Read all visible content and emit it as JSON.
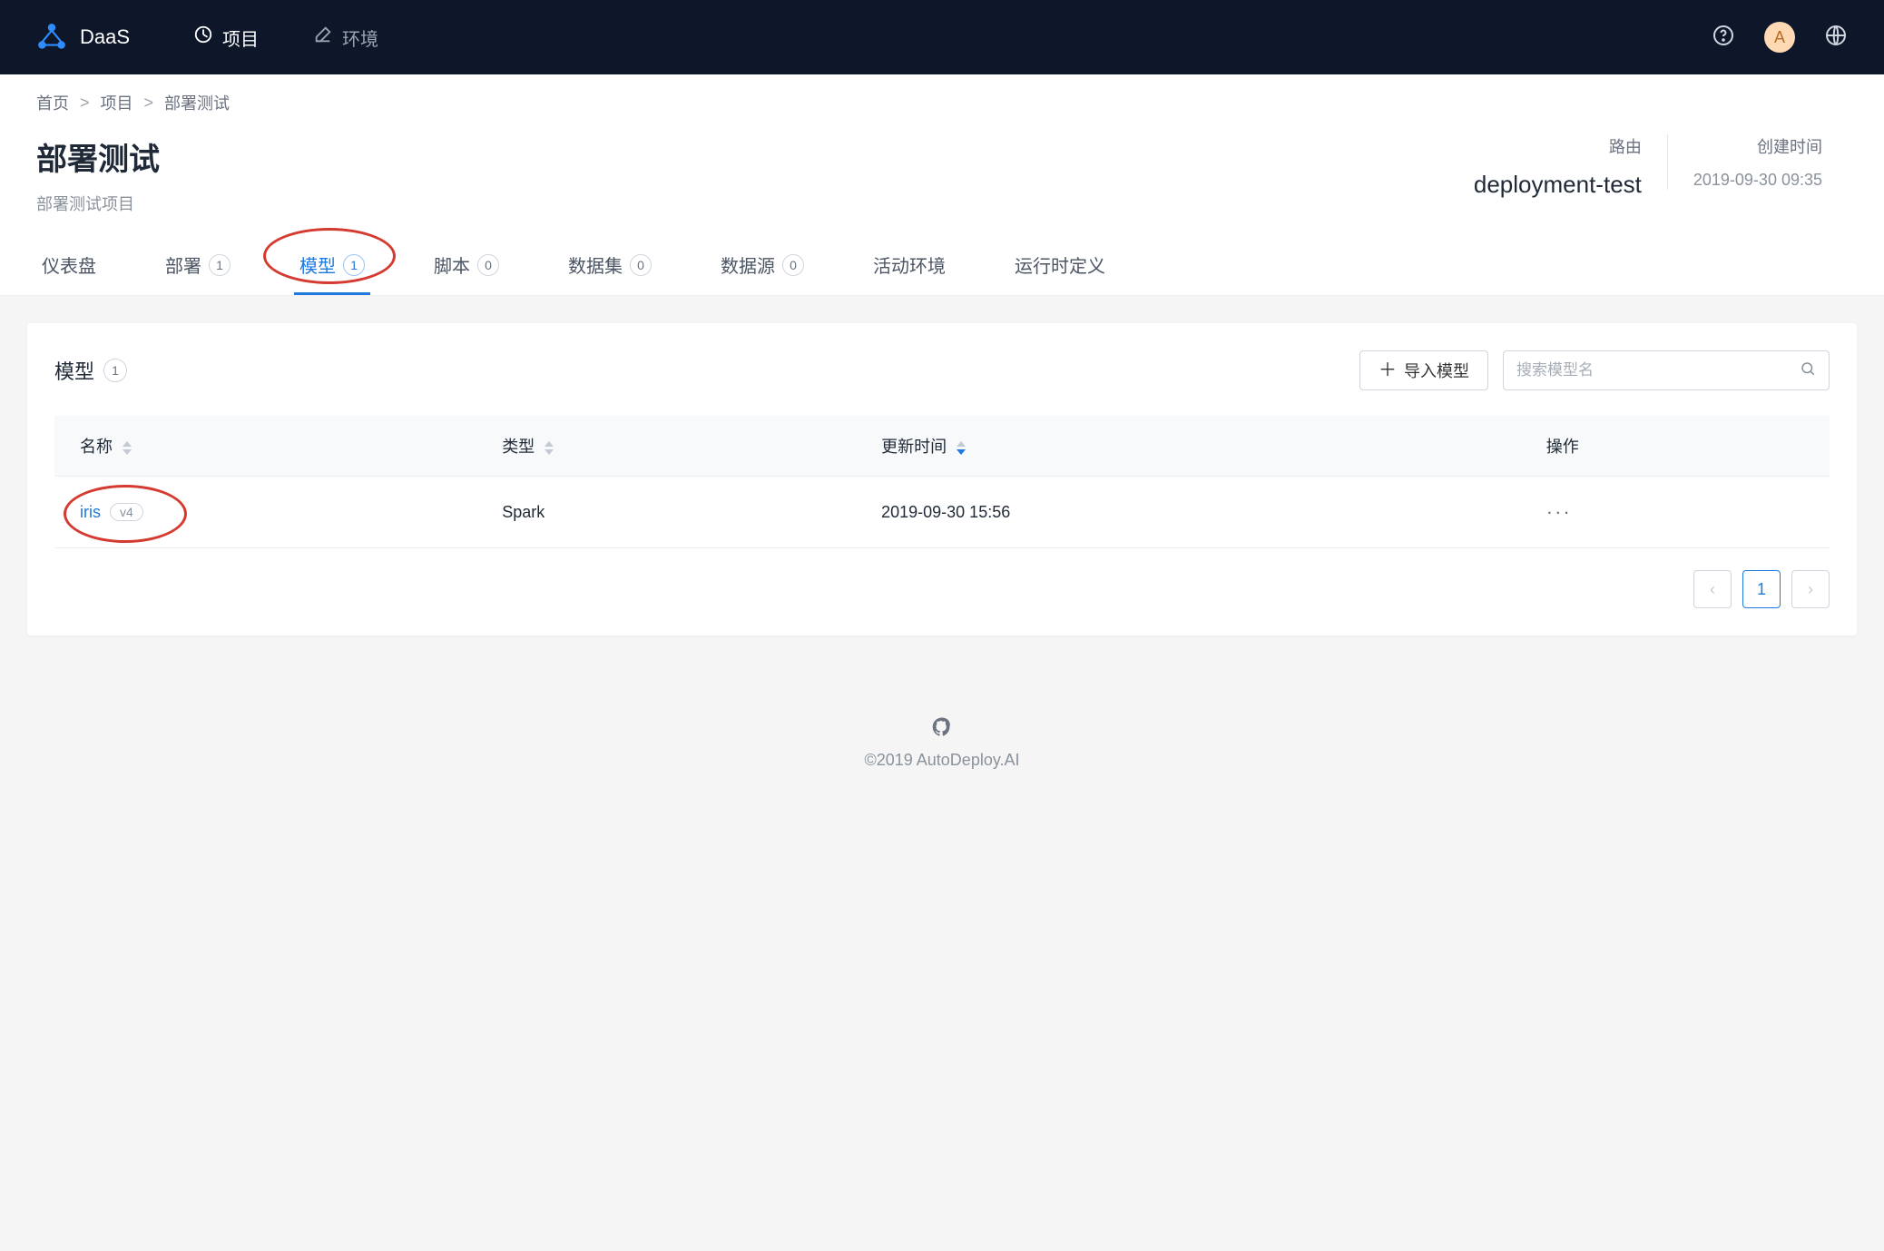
{
  "brand": {
    "name": "DaaS"
  },
  "nav": {
    "project": "项目",
    "environment": "环境",
    "avatar_initial": "A"
  },
  "breadcrumb": {
    "home": "首页",
    "project": "项目",
    "current": "部署测试",
    "sep": ">"
  },
  "page": {
    "title": "部署测试",
    "subtitle": "部署测试项目"
  },
  "meta": {
    "route_label": "路由",
    "route_value": "deployment-test",
    "created_label": "创建时间",
    "created_value": "2019-09-30 09:35"
  },
  "tabs": {
    "dashboard": "仪表盘",
    "deploy": "部署",
    "deploy_count": "1",
    "model": "模型",
    "model_count": "1",
    "script": "脚本",
    "script_count": "0",
    "dataset": "数据集",
    "dataset_count": "0",
    "datasource": "数据源",
    "datasource_count": "0",
    "active_env": "活动环境",
    "runtime_def": "运行时定义"
  },
  "panel": {
    "title": "模型",
    "count": "1",
    "import_btn": "导入模型",
    "search_placeholder": "搜索模型名"
  },
  "table": {
    "cols": {
      "name": "名称",
      "type": "类型",
      "updated": "更新时间",
      "actions": "操作"
    },
    "rows": [
      {
        "name": "iris",
        "version": "v4",
        "type": "Spark",
        "updated": "2019-09-30 15:56"
      }
    ]
  },
  "pagination": {
    "current": "1"
  },
  "footer": {
    "copyright": "©2019 AutoDeploy.AI"
  }
}
